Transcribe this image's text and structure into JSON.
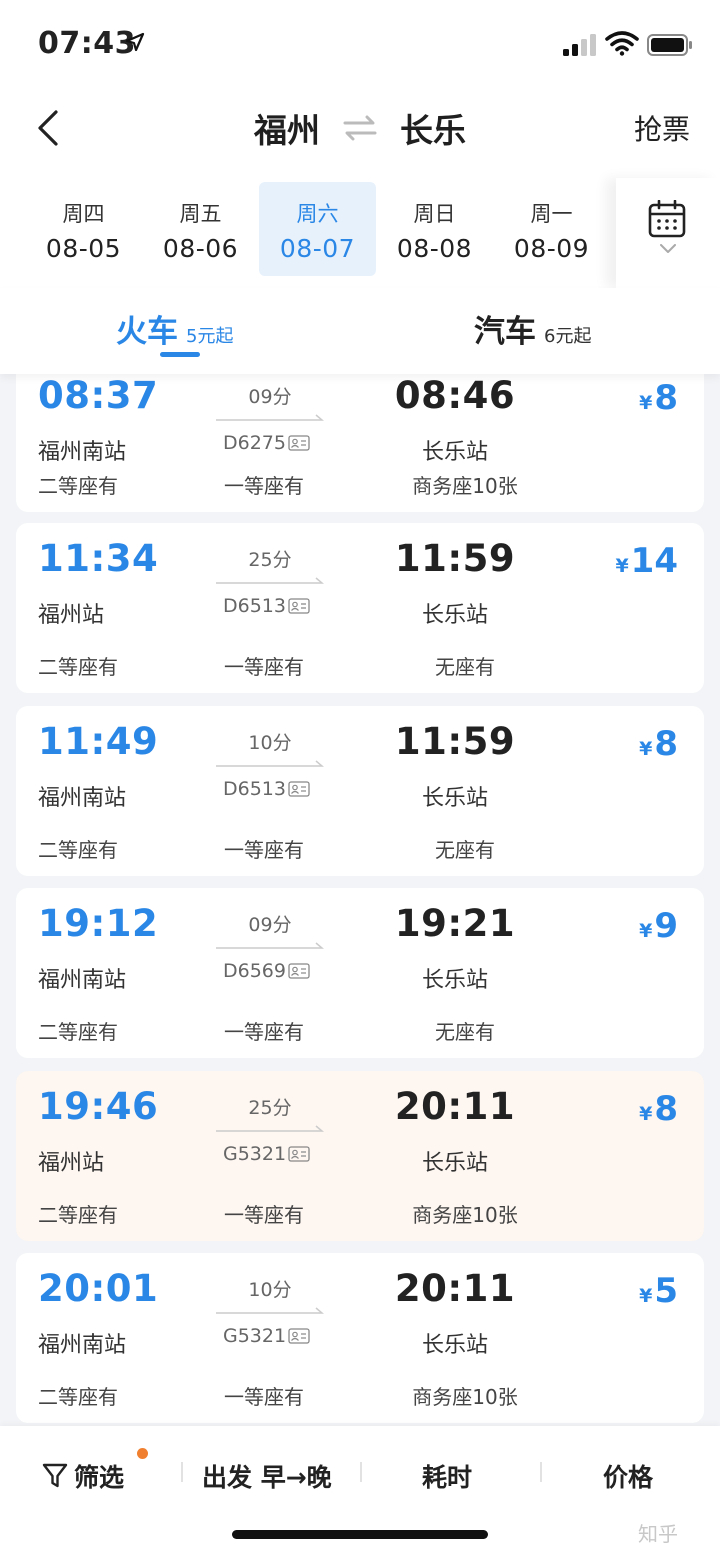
{
  "status": {
    "time": "07:43"
  },
  "header": {
    "from": "福州",
    "to": "长乐",
    "action": "抢票"
  },
  "dates": [
    {
      "weekday": "周四",
      "date": "08-05",
      "active": false
    },
    {
      "weekday": "周五",
      "date": "08-06",
      "active": false
    },
    {
      "weekday": "周六",
      "date": "08-07",
      "active": true
    },
    {
      "weekday": "周日",
      "date": "08-08",
      "active": false
    },
    {
      "weekday": "周一",
      "date": "08-09",
      "active": false
    }
  ],
  "modes": {
    "train": {
      "label": "火车",
      "price": "5元起"
    },
    "bus": {
      "label": "汽车",
      "price": "6元起"
    }
  },
  "currency": "¥",
  "trains": [
    {
      "dep_time": "08:37",
      "dep_station": "福州南站",
      "duration": "09分",
      "train_no": "D6275",
      "arr_time": "08:46",
      "arr_station": "长乐站",
      "price": "8",
      "seats": [
        "二等座有",
        "一等座有",
        "商务座10张"
      ],
      "highlight": false
    },
    {
      "dep_time": "11:34",
      "dep_station": "福州站",
      "duration": "25分",
      "train_no": "D6513",
      "arr_time": "11:59",
      "arr_station": "长乐站",
      "price": "14",
      "seats": [
        "二等座有",
        "一等座有",
        "无座有"
      ],
      "highlight": false
    },
    {
      "dep_time": "11:49",
      "dep_station": "福州南站",
      "duration": "10分",
      "train_no": "D6513",
      "arr_time": "11:59",
      "arr_station": "长乐站",
      "price": "8",
      "seats": [
        "二等座有",
        "一等座有",
        "无座有"
      ],
      "highlight": false
    },
    {
      "dep_time": "19:12",
      "dep_station": "福州南站",
      "duration": "09分",
      "train_no": "D6569",
      "arr_time": "19:21",
      "arr_station": "长乐站",
      "price": "9",
      "seats": [
        "二等座有",
        "一等座有",
        "无座有"
      ],
      "highlight": false
    },
    {
      "dep_time": "19:46",
      "dep_station": "福州站",
      "duration": "25分",
      "train_no": "G5321",
      "arr_time": "20:11",
      "arr_station": "长乐站",
      "price": "8",
      "seats": [
        "二等座有",
        "一等座有",
        "商务座10张"
      ],
      "highlight": true
    },
    {
      "dep_time": "20:01",
      "dep_station": "福州南站",
      "duration": "10分",
      "train_no": "G5321",
      "arr_time": "20:11",
      "arr_station": "长乐站",
      "price": "5",
      "seats": [
        "二等座有",
        "一等座有",
        "商务座10张"
      ],
      "highlight": false
    }
  ],
  "sort_bar": {
    "filter": "筛选",
    "depart": "出发 早→晚",
    "duration": "耗时",
    "price": "价格"
  },
  "watermark": "知乎"
}
